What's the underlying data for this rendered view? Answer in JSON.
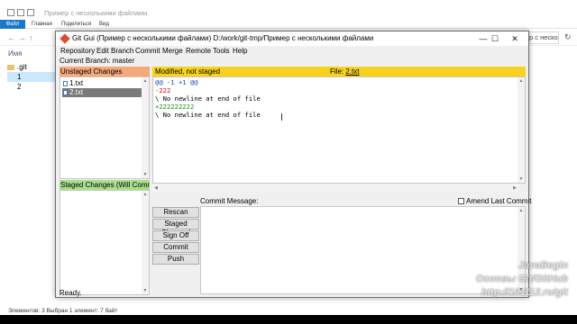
{
  "explorer": {
    "title": "Пример с несколькими файлами",
    "ribbon_tabs": [
      "Файл",
      "Главная",
      "Поделиться",
      "Вид"
    ],
    "address_right": "р с несколь",
    "column_name": "Имя",
    "nav_items": [
      {
        "label": ".git",
        "selected": false
      },
      {
        "label": "1",
        "selected": true
      },
      {
        "label": "2",
        "selected": false
      }
    ],
    "status": "Элементов: 3    Выбран 1 элемент: 7 байт"
  },
  "gitgui": {
    "title": "Git Gui (Пример с несколькими файлами) D:/work/git-tmp/Пример с несколькими файлами",
    "menu": [
      "Repository",
      "Edit",
      "Branch",
      "Commit",
      "Merge",
      "Remote",
      "Tools",
      "Help"
    ],
    "current_branch": "Current Branch: master",
    "unstaged": {
      "header": "Unstaged Changes",
      "files": [
        {
          "name": "1.txt",
          "selected": false
        },
        {
          "name": "2.txt",
          "selected": true
        }
      ]
    },
    "staged": {
      "header": "Staged Changes (Will Commit)"
    },
    "diff": {
      "status": "Modified, not staged",
      "file_label": "File:",
      "file_name": "2.txt",
      "lines": [
        {
          "text": "@@ -1 +1 @@",
          "kind": "hunk"
        },
        {
          "text": "-222",
          "kind": "del"
        },
        {
          "text": "\\ No newline at end of file",
          "kind": "ctx"
        },
        {
          "text": "+222222222",
          "kind": "add"
        },
        {
          "text": "\\ No newline at end of file",
          "kind": "ctx"
        }
      ]
    },
    "commit": {
      "message_label": "Commit Message:",
      "amend_label": "Amend Last Commit",
      "buttons": [
        "Rescan",
        "Staged Changed",
        "Sign Off",
        "Commit",
        "Push"
      ]
    },
    "status": "Ready."
  },
  "watermark": {
    "line1": "JavaBegin",
    "line2": "Основы Git/GitHub",
    "line3": "http://101112.ru/git"
  }
}
